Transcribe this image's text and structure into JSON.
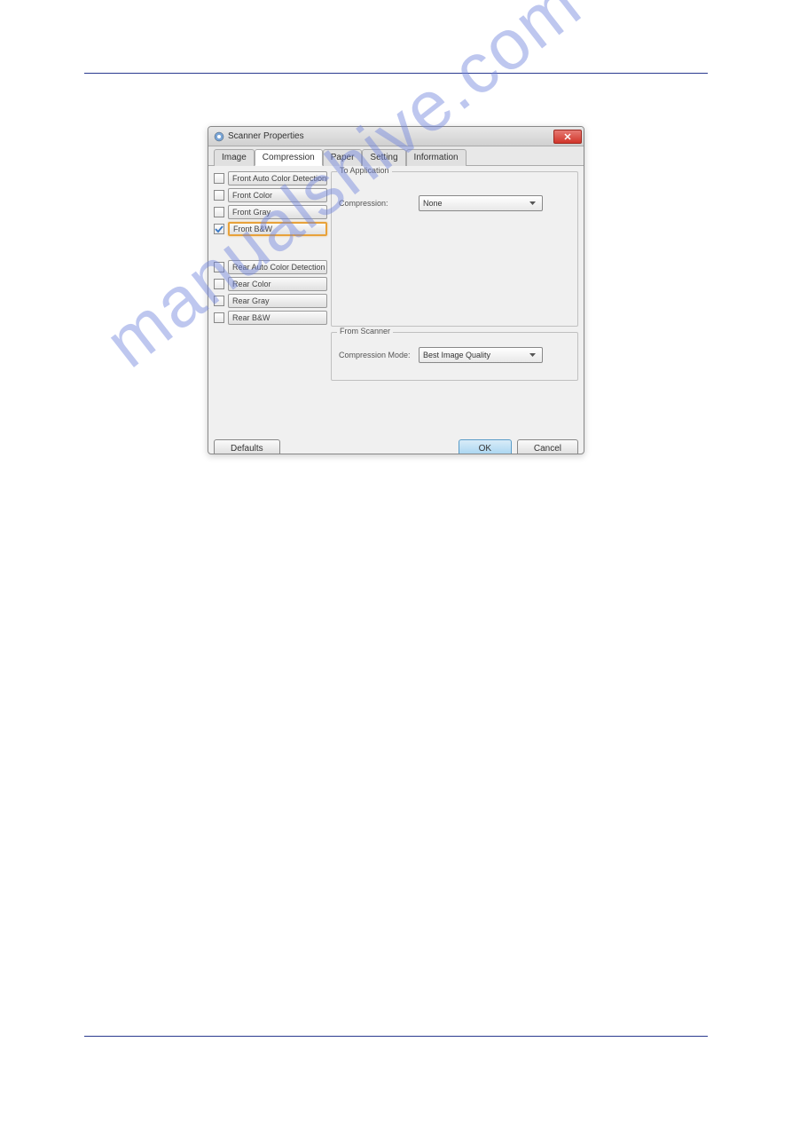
{
  "watermark": "manualshive.com",
  "dialog": {
    "title": "Scanner Properties",
    "tabs": {
      "image": "Image",
      "compression": "Compression",
      "paper": "Paper",
      "setting": "Setting",
      "information": "Information"
    },
    "left_options": {
      "front_auto": "Front Auto Color Detection",
      "front_color": "Front Color",
      "front_gray": "Front Gray",
      "front_bw": "Front B&W",
      "rear_auto": "Rear Auto Color Detection",
      "rear_color": "Rear Color",
      "rear_gray": "Rear Gray",
      "rear_bw": "Rear B&W"
    },
    "to_application": {
      "group_label": "To Application",
      "compression_label": "Compression:",
      "compression_value": "None"
    },
    "from_scanner": {
      "group_label": "From Scanner",
      "mode_label": "Compression Mode:",
      "mode_value": "Best Image Quality"
    },
    "buttons": {
      "defaults": "Defaults",
      "ok": "OK",
      "cancel": "Cancel"
    }
  }
}
